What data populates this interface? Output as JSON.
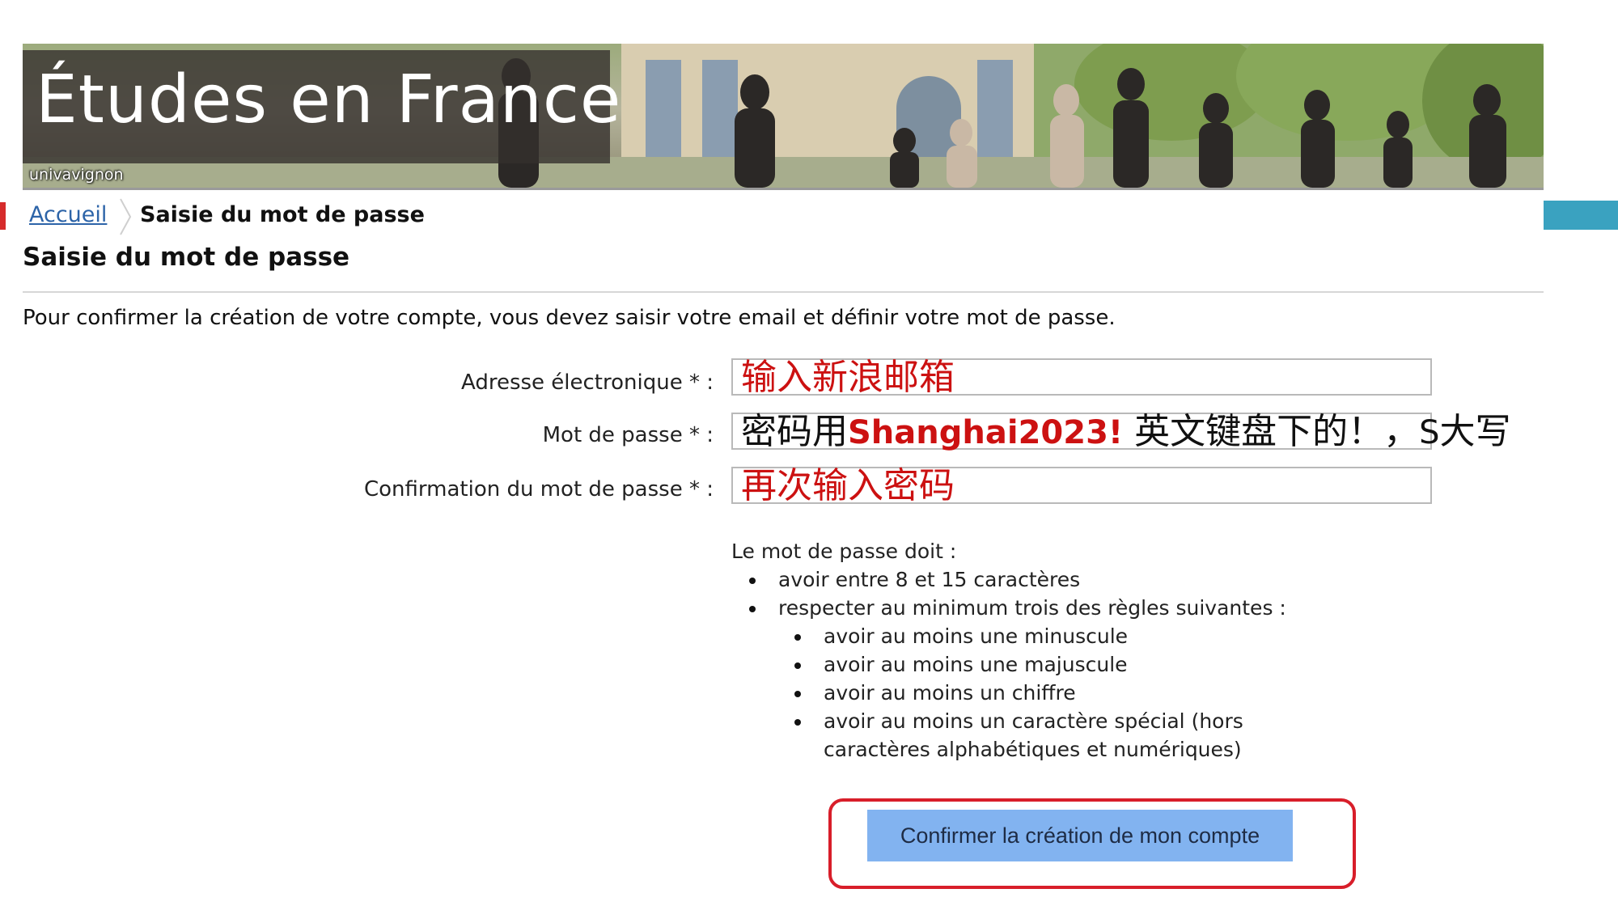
{
  "banner": {
    "title": "Études en France",
    "logo_text": "univavignon"
  },
  "breadcrumb": {
    "home_label": "Accueil",
    "current_label": "Saisie du mot de passe"
  },
  "page": {
    "title": "Saisie du mot de passe",
    "intro": "Pour confirmer la création de votre compte, vous devez saisir votre email et définir votre mot de passe."
  },
  "form": {
    "email": {
      "label": "Adresse électronique * :",
      "value": "输入新浪邮箱"
    },
    "password": {
      "label": "Mot de passe * :",
      "note_prefix": "密码用",
      "note_password": "Shanghai2023!",
      "note_middle": " 英文键盘下的！，",
      "note_s": "S",
      "note_suffix": "大写"
    },
    "confirm": {
      "label": "Confirmation du mot de passe * :",
      "value": "再次输入密码"
    }
  },
  "rules": {
    "intro": "Le mot de passe doit :",
    "items": [
      "avoir entre 8 et 15 caractères",
      "respecter au minimum trois des règles suivantes :"
    ],
    "sub_items": [
      "avoir au moins une minuscule",
      "avoir au moins une majuscule",
      "avoir au moins un chiffre",
      "avoir au moins un caractère spécial (hors",
      "caractères alphabétiques et numériques)"
    ]
  },
  "actions": {
    "confirm_label": "Confirmer la création de mon compte"
  },
  "colors": {
    "button_bg": "#82b3f0",
    "highlight_outline": "#d81e2a",
    "annotation_text": "#cc1111",
    "link": "#2d64a8"
  }
}
